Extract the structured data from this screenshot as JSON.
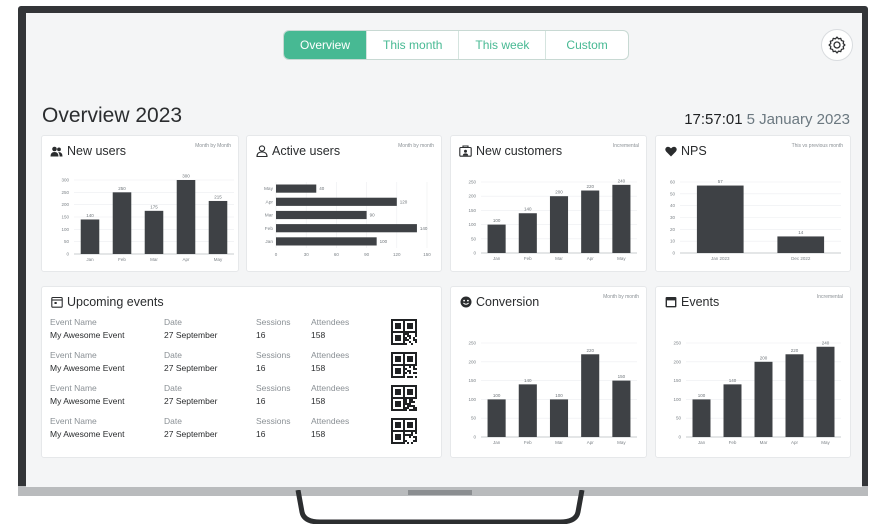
{
  "tabs": [
    {
      "label": "Overview",
      "active": true
    },
    {
      "label": "This month",
      "active": false
    },
    {
      "label": "This week",
      "active": false
    },
    {
      "label": "Custom",
      "active": false
    }
  ],
  "settings_icon": "gear-icon",
  "page_title": "Overview 2023",
  "clock": {
    "time": "17:57:01",
    "date": "5 January 2023"
  },
  "accent_color": "#47b993",
  "bar_color": "#3e4145",
  "cards": {
    "new_users": {
      "title": "New users",
      "subtitle": "Month by Month",
      "icon": "users-icon"
    },
    "active_users": {
      "title": "Active users",
      "subtitle": "Month by month",
      "icon": "user-icon"
    },
    "new_customers": {
      "title": "New customers",
      "subtitle": "Incremental",
      "icon": "customers-icon"
    },
    "nps": {
      "title": "NPS",
      "subtitle": "This vs previous month",
      "icon": "heart-icon"
    },
    "upcoming_events": {
      "title": "Upcoming events",
      "icon": "calendar-icon"
    },
    "conversion": {
      "title": "Conversion",
      "subtitle": "Month by month",
      "icon": "smiley-icon"
    },
    "events": {
      "title": "Events",
      "subtitle": "Incremental",
      "icon": "events-icon"
    }
  },
  "events_table": {
    "headers": {
      "name": "Event Name",
      "date": "Date",
      "sessions": "Sessions",
      "attendees": "Attendees"
    },
    "rows": [
      {
        "name": "My Awesome Event",
        "date": "27 September",
        "sessions": "16",
        "attendees": "158"
      },
      {
        "name": "My Awesome Event",
        "date": "27 September",
        "sessions": "16",
        "attendees": "158"
      },
      {
        "name": "My Awesome Event",
        "date": "27 September",
        "sessions": "16",
        "attendees": "158"
      },
      {
        "name": "My Awesome Event",
        "date": "27 September",
        "sessions": "16",
        "attendees": "158"
      }
    ]
  },
  "chart_data": [
    {
      "id": "new_users",
      "type": "bar",
      "categories": [
        "Jan",
        "Feb",
        "Mar",
        "Apr",
        "May"
      ],
      "values": [
        140,
        250,
        175,
        300,
        215
      ],
      "yticks": [
        0,
        50,
        100,
        150,
        200,
        250,
        300
      ],
      "ylim": [
        0,
        300
      ],
      "data_labels": [
        "140",
        "250",
        "175",
        "300",
        "215"
      ]
    },
    {
      "id": "active_users",
      "type": "bar",
      "orientation": "horizontal",
      "categories": [
        "May",
        "Apr",
        "Mar",
        "Feb",
        "Jan"
      ],
      "values": [
        40,
        120,
        90,
        140,
        100
      ],
      "xticks": [
        0,
        30,
        60,
        90,
        120,
        150
      ],
      "xlim": [
        0,
        150
      ],
      "data_labels": [
        "40",
        "120",
        "90",
        "140",
        "100"
      ]
    },
    {
      "id": "new_customers",
      "type": "bar",
      "categories": [
        "Jan",
        "Feb",
        "Mar",
        "Apr",
        "May"
      ],
      "values": [
        100,
        140,
        200,
        220,
        240
      ],
      "yticks": [
        0,
        50,
        100,
        150,
        200,
        250
      ],
      "ylim": [
        0,
        250
      ],
      "data_labels": [
        "100",
        "140",
        "200",
        "220",
        "240"
      ]
    },
    {
      "id": "nps",
      "type": "bar",
      "categories": [
        "Jan 2023",
        "Dec 2022"
      ],
      "values": [
        57,
        14
      ],
      "yticks": [
        0,
        10,
        20,
        30,
        40,
        50,
        60
      ],
      "ylim": [
        0,
        60
      ],
      "data_labels": [
        "57",
        "14"
      ]
    },
    {
      "id": "conversion",
      "type": "bar",
      "categories": [
        "Jan",
        "Feb",
        "Mar",
        "Apr",
        "May"
      ],
      "values": [
        100,
        140,
        100,
        220,
        150
      ],
      "yticks": [
        0,
        50,
        100,
        150,
        200,
        250
      ],
      "ylim": [
        0,
        250
      ],
      "data_labels": [
        "100",
        "140",
        "100",
        "220",
        "150"
      ]
    },
    {
      "id": "events",
      "type": "bar",
      "categories": [
        "Jan",
        "Feb",
        "Mar",
        "Apr",
        "May"
      ],
      "values": [
        100,
        140,
        200,
        220,
        240
      ],
      "yticks": [
        0,
        50,
        100,
        150,
        200,
        250
      ],
      "ylim": [
        0,
        250
      ],
      "data_labels": [
        "100",
        "140",
        "200",
        "220",
        "240"
      ]
    }
  ]
}
